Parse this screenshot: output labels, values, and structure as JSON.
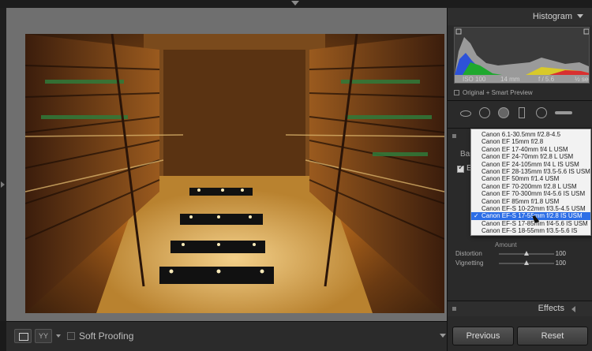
{
  "toolbar": {
    "loupe_icon": "loupe-view-icon",
    "compare_label": "YY",
    "soft_proofing_label": "Soft Proofing"
  },
  "histogram": {
    "title": "Histogram",
    "iso": "ISO 100",
    "focal_length": "14 mm",
    "aperture": "f / 5.6",
    "shutter": "½ sec",
    "preview_status": "Original + Smart Preview"
  },
  "lens_panel": {
    "tab_label": "Bas",
    "enable_label": "E",
    "amount_label": "Amount",
    "sliders": [
      {
        "label": "Distortion",
        "value": "100",
        "fraction": 0.5
      },
      {
        "label": "Vignetting",
        "value": "100",
        "fraction": 0.5
      }
    ]
  },
  "lens_menu": {
    "items": [
      "Canon 6.1-30.5mm f/2.8-4.5",
      "Canon EF 15mm f/2.8",
      "Canon EF 17-40mm f/4 L USM",
      "Canon EF 24-70mm f/2.8 L USM",
      "Canon EF 24-105mm f/4 L IS USM",
      "Canon EF 28-135mm f/3.5-5.6 IS USM",
      "Canon EF 50mm f/1.4 USM",
      "Canon EF 70-200mm f/2.8 L USM",
      "Canon EF 70-300mm f/4-5.6 IS USM",
      "Canon EF 85mm f/1.8 USM",
      "Canon EF-S 10-22mm f/3.5-4.5 USM",
      "Canon EF-S 17-55mm f/2.8 IS USM",
      "Canon EF-S 17-85mm f/4-5.6 IS USM",
      "Canon EF-S 18-55mm f/3.5-5.6 IS"
    ],
    "selected_index": 11,
    "check_mark": "✓"
  },
  "effects": {
    "title": "Effects"
  },
  "buttons": {
    "previous": "Previous",
    "reset": "Reset"
  }
}
